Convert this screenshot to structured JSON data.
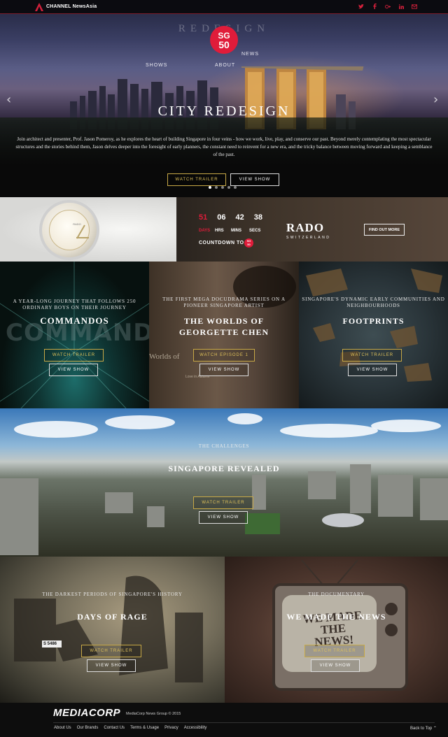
{
  "header": {
    "logo_text": "CHANNEL NewsAsia",
    "social_icons": [
      "twitter-icon",
      "facebook-icon",
      "google-plus-icon",
      "linkedin-icon",
      "email-icon"
    ],
    "accent_color": "#d3203b"
  },
  "hero": {
    "ghost_title": "REDESIGN",
    "badge_line1": "SG",
    "badge_line2": "50",
    "nav": {
      "shows": "SHOWS",
      "news": "NEWS",
      "about": "ABOUT"
    },
    "title": "CITY REDESIGN",
    "description": "Join architect and presenter, Prof. Jason Pomeroy, as he explores the heart of building Singapore in four veins - how we work, live, play, and conserve our past. Beyond merely contemplating the most spectacular structures and the stories behind them, Jason delves deeper into the foresight of early planners, the constant need to reinvent for a new era, and the tricky balance between moving forward and keeping a semblance of the past.",
    "watch_trailer": "WATCH TRAILER",
    "view_show": "VIEW SHOW",
    "slide_count": 5,
    "active_slide": 1
  },
  "ad": {
    "watch_brand": "RADO",
    "countdown": {
      "days": "51",
      "hrs": "06",
      "mins": "42",
      "secs": "38",
      "days_label": "DAYS",
      "hrs_label": "HRS",
      "mins_label": "MINS",
      "secs_label": "SECS",
      "title": "COUNTDOWN TO",
      "badge_line1": "SG",
      "badge_line2": "50"
    },
    "brand_name": "RADO",
    "brand_sub": "SWITZERLAND",
    "find_out_more": "FIND OUT MORE"
  },
  "shows": [
    {
      "subtitle": "A YEAR-LONG JOURNEY THAT FOLLOWS 250 ORDINARY BOYS ON THEIR JOURNEY",
      "title": "COMMANDOS",
      "primary": "WATCH TRAILER",
      "secondary": "VIEW SHOW"
    },
    {
      "subtitle": "THE FIRST MEGA DOCUDRAMA SERIES ON A PIONEER SINGAPORE ARTIST",
      "title": "THE WORLDS OF GEORGETTE CHEN",
      "primary": "WATCH EPISODE 1",
      "secondary": "VIEW SHOW",
      "art_text": "Worlds of",
      "art_text2": "Love in Autumn"
    },
    {
      "subtitle": "SINGAPORE'S DYNAMIC EARLY COMMUNITIES AND NEIGHBOURHOODS",
      "title": "FOOTPRINTS",
      "primary": "WATCH TRAILER",
      "secondary": "VIEW SHOW"
    },
    {
      "subtitle": "THE CHALLENGES",
      "title": "SINGAPORE REVEALED",
      "primary": "WATCH TRAILER",
      "secondary": "VIEW SHOW"
    },
    {
      "subtitle": "THE DARKEST PERIODS OF SINGAPORE'S HISTORY",
      "title": "DAYS OF RAGE",
      "primary": "WATCH TRAILER",
      "secondary": "VIEW SHOW",
      "plate": "S 5486"
    },
    {
      "subtitle": "THE DOCUMENTARY",
      "title": "WE MADE THE NEWS",
      "primary": "WATCH TRAILER",
      "secondary": "VIEW SHOW",
      "tv_text1": "WE MADE",
      "tv_text2": "THE",
      "tv_text3": "NEWS!"
    }
  ],
  "footer": {
    "logo": "MEDIACORP",
    "copyright": "MediaCorp News Group © 2015",
    "links": [
      "About Us",
      "Our Brands",
      "Contact Us",
      "Terms & Usage",
      "Privacy",
      "Accessibility"
    ],
    "back_to_top": "Back to Top"
  }
}
